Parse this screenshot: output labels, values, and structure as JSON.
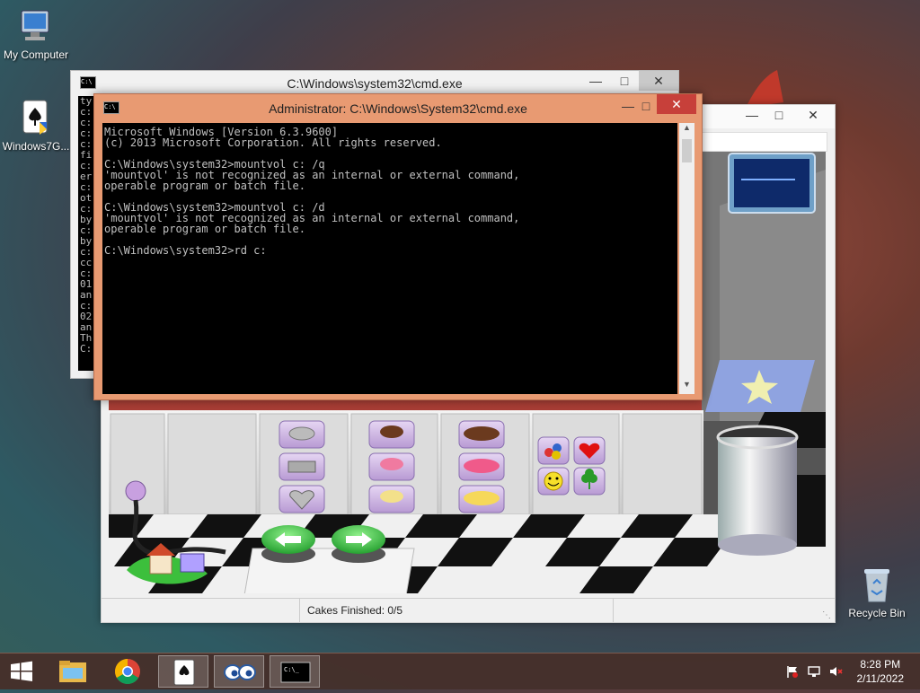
{
  "desktop": {
    "icons": [
      {
        "label": "My Computer"
      },
      {
        "label": "Windows7G..."
      },
      {
        "label": "Recycle Bin"
      }
    ]
  },
  "game_window": {
    "status_text": "Cakes Finished: 0/5"
  },
  "cmd_back": {
    "title": "C:\\Windows\\system32\\cmd.exe",
    "lines": [
      "ty",
      "c:",
      "c:",
      "c:",
      "c:",
      "fi",
      "c:",
      "er",
      "c:",
      "ot",
      "c:",
      "by",
      "c:",
      "by",
      "c:",
      "cc",
      "c:",
      "01",
      "an",
      "c:",
      "02",
      "an",
      "Th",
      "",
      "C:"
    ]
  },
  "cmd_front": {
    "title": "Administrator: C:\\Windows\\System32\\cmd.exe",
    "lines": [
      "Microsoft Windows [Version 6.3.9600]",
      "(c) 2013 Microsoft Corporation. All rights reserved.",
      "",
      "C:\\Windows\\system32>mountvol c: /q",
      "'mountvol' is not recognized as an internal or external command,",
      "operable program or batch file.",
      "",
      "C:\\Windows\\system32>mountvol c: /d",
      "'mountvol' is not recognized as an internal or external command,",
      "operable program or batch file.",
      "",
      "C:\\Windows\\system32>rd c:"
    ]
  },
  "taskbar": {
    "clock_time": "8:28 PM",
    "clock_date": "2/11/2022"
  },
  "colors": {
    "cmd_front_frame": "#e89a72",
    "taskbar": "#462e28"
  }
}
